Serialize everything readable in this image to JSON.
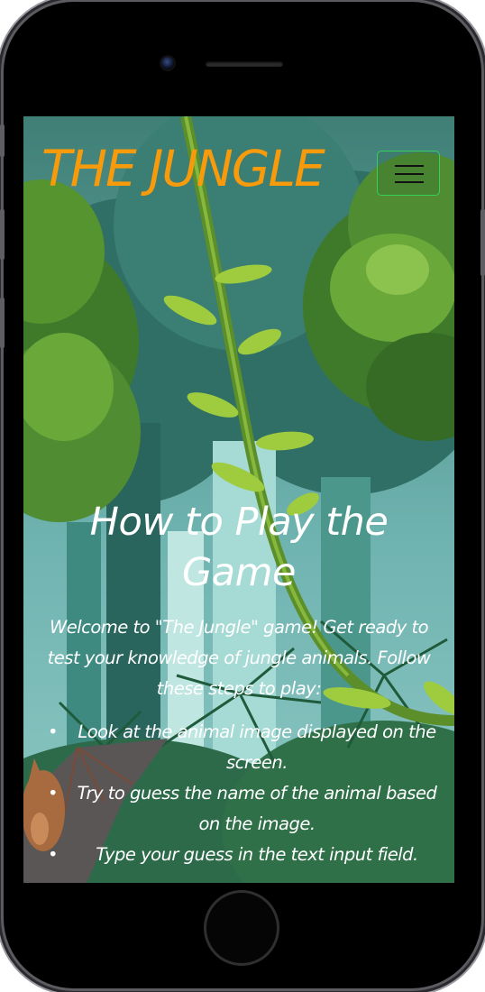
{
  "navbar": {
    "brand": "THE JUNGLE",
    "toggler_icon": "hamburger-menu-icon"
  },
  "main": {
    "title": "How to Play the Game",
    "intro": "Welcome to \"The Jungle\" game! Get ready to test your knowledge of jungle animals. Follow these steps to play:",
    "steps": [
      "Look at the animal image displayed on the screen.",
      "Try to guess the name of the animal based on the image.",
      "Type your guess in the text input field."
    ]
  },
  "colors": {
    "brand": "#f79a0c",
    "toggler_border": "#38d05a",
    "text": "#ffffff",
    "jungle_background": "#2d6a64"
  }
}
